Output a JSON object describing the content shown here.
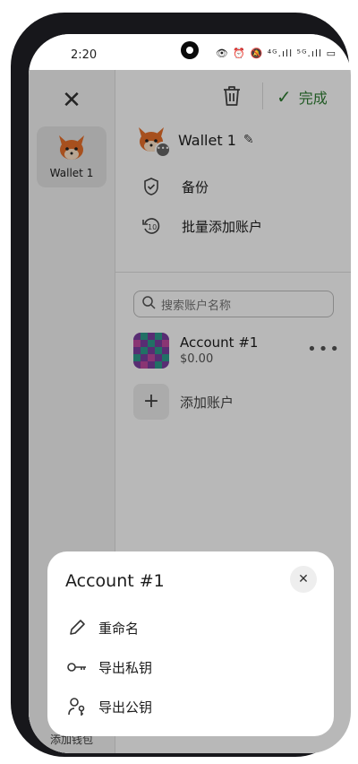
{
  "status": {
    "time": "2:20",
    "icons": "👁 ⏰ 🔕 ⁴ᴳ.ıll ⁵ᴳ.ıll ▭"
  },
  "sidebar": {
    "wallet_label": "Wallet 1",
    "add_wallet": "添加钱包"
  },
  "header": {
    "done": "完成"
  },
  "wallet": {
    "name": "Wallet 1"
  },
  "menu": {
    "backup": "备份",
    "batch_add": "批量添加账户"
  },
  "search": {
    "placeholder": "搜索账户名称"
  },
  "account": {
    "name": "Account #1",
    "balance": "$0.00"
  },
  "add_account": "添加账户",
  "sheet": {
    "title": "Account #1",
    "items": [
      "重命名",
      "导出私钥",
      "导出公钥"
    ]
  },
  "colors": {
    "accent": "#2e7d32",
    "overlay": "rgba(0,0,0,0.28)"
  }
}
